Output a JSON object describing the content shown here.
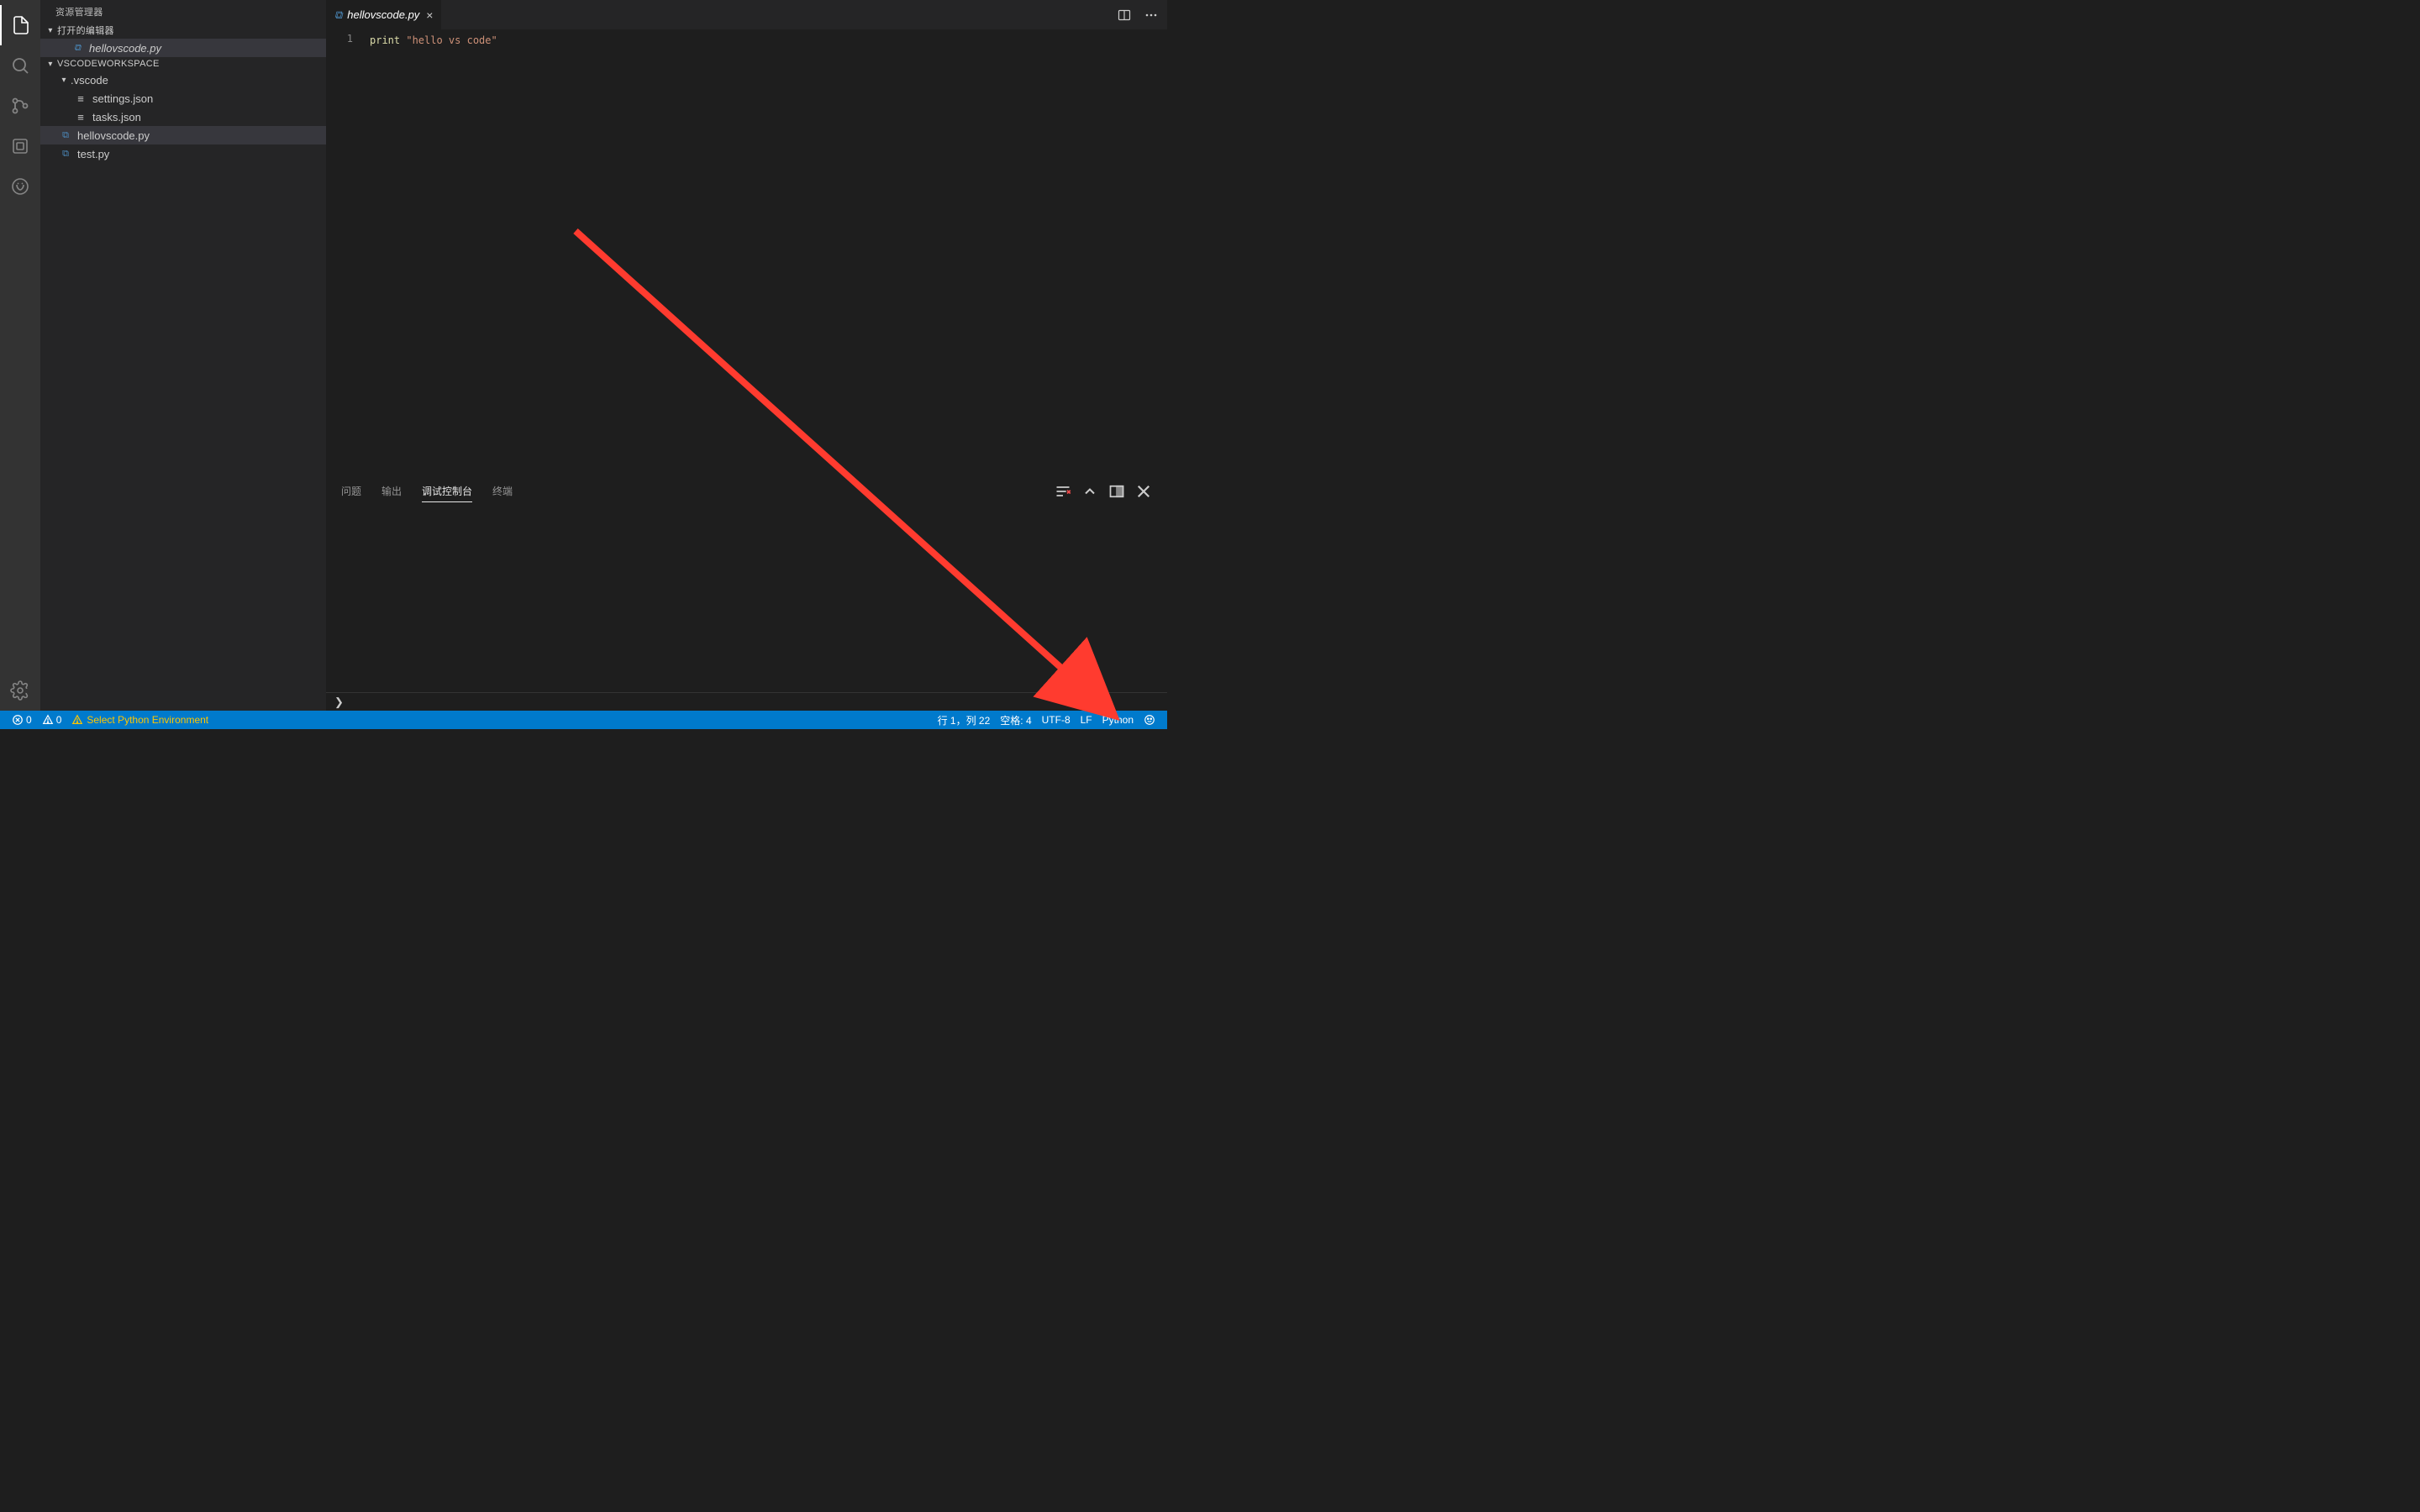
{
  "sidebar": {
    "title": "资源管理器",
    "open_editors_label": "打开的编辑器",
    "open_editors": [
      {
        "name": "hellovscode.py",
        "icon": "py"
      }
    ],
    "workspace_label": "VSCODEWORKSPACE",
    "tree": {
      "vscode_folder": ".vscode",
      "settings": "settings.json",
      "tasks": "tasks.json",
      "hello": "hellovscode.py",
      "test": "test.py"
    }
  },
  "tabs": {
    "active": {
      "name": "hellovscode.py",
      "icon": "py"
    }
  },
  "editor": {
    "line_number": "1",
    "tok_print": "print",
    "tok_space": " ",
    "tok_string": "\"hello vs code\""
  },
  "panel": {
    "tabs": {
      "problems": "问题",
      "output": "输出",
      "debug": "调试控制台",
      "terminal": "终端"
    },
    "prompt": "❯"
  },
  "status": {
    "errors_badge": "0",
    "warnings_badge": "0",
    "select_python": "Select Python Environment",
    "cursor": "行 1，列 22",
    "indent": "空格: 4",
    "encoding": "UTF-8",
    "eol": "LF",
    "language": "Python"
  }
}
